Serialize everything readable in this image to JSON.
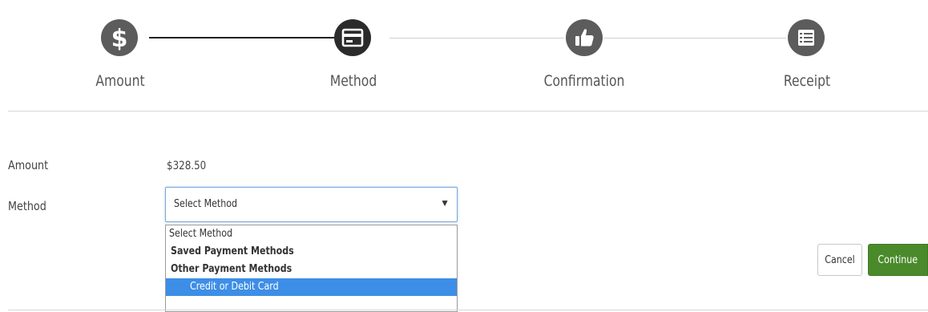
{
  "stepper": {
    "steps": [
      {
        "label": "Amount",
        "icon": "dollar-icon",
        "state": "complete"
      },
      {
        "label": "Method",
        "icon": "credit-card-icon",
        "state": "active"
      },
      {
        "label": "Confirmation",
        "icon": "thumbs-up-icon",
        "state": "pending"
      },
      {
        "label": "Receipt",
        "icon": "list-icon",
        "state": "pending"
      }
    ]
  },
  "form": {
    "amount_label": "Amount",
    "amount_value": "$328.50",
    "method_label": "Method",
    "method_select": {
      "selected": "Select Method",
      "options": [
        {
          "label": "Select Method",
          "kind": "option"
        },
        {
          "label": "Saved Payment Methods",
          "kind": "group"
        },
        {
          "label": "Other Payment Methods",
          "kind": "group"
        },
        {
          "label": "Credit or Debit Card",
          "kind": "option",
          "highlighted": true
        }
      ]
    }
  },
  "buttons": {
    "cancel_label": "Cancel",
    "continue_label": "Continue"
  },
  "colors": {
    "step_complete": "#5c5c5c",
    "step_active": "#2b2b2b",
    "continue_button": "#4a8a2b",
    "option_highlight": "#3d8ee6",
    "select_focus_border": "#7aa7d8"
  }
}
